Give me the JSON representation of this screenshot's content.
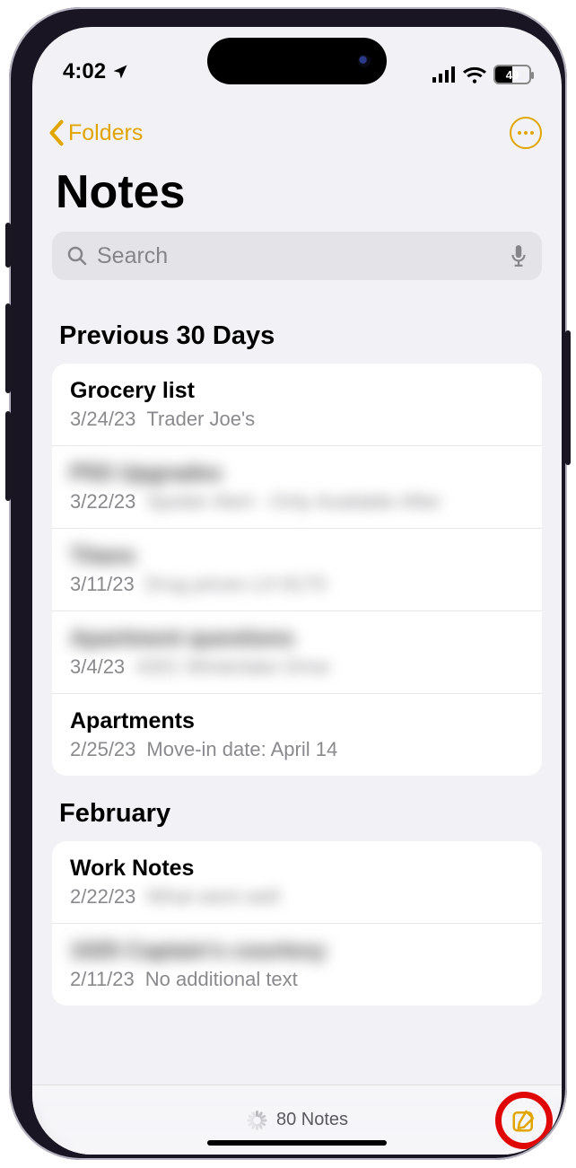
{
  "status": {
    "time": "4:02",
    "batteryPercent": "49"
  },
  "nav": {
    "back": "Folders"
  },
  "title": "Notes",
  "search": {
    "placeholder": "Search"
  },
  "sections": [
    {
      "title": "Previous 30 Days",
      "rows": [
        {
          "title": "Grocery list",
          "date": "3/24/23",
          "preview": "Trader Joe's",
          "blurred": false
        },
        {
          "title": "P5S Upgrades",
          "date": "3/22/23",
          "preview": "Spoiler Alert - Only Available After",
          "blurred": true
        },
        {
          "title": "Titans",
          "date": "3/11/23",
          "preview": "Drug prices LH 8170",
          "blurred": true
        },
        {
          "title": "Apartment questions",
          "date": "3/4/23",
          "preview": "4301 Winterlake Drive",
          "blurred": true
        },
        {
          "title": "Apartments",
          "date": "2/25/23",
          "preview": "Move-in date: April 14",
          "blurred": false
        }
      ]
    },
    {
      "title": "February",
      "rows": [
        {
          "title": "Work Notes",
          "date": "2/22/23",
          "preview": "What went well",
          "blurred": false,
          "previewBlurred": true
        },
        {
          "title": "1025 Captain's courtesy",
          "date": "2/11/23",
          "preview": "No additional text",
          "blurred": true,
          "previewBlurred": false
        }
      ]
    }
  ],
  "footer": {
    "count": "80 Notes"
  }
}
